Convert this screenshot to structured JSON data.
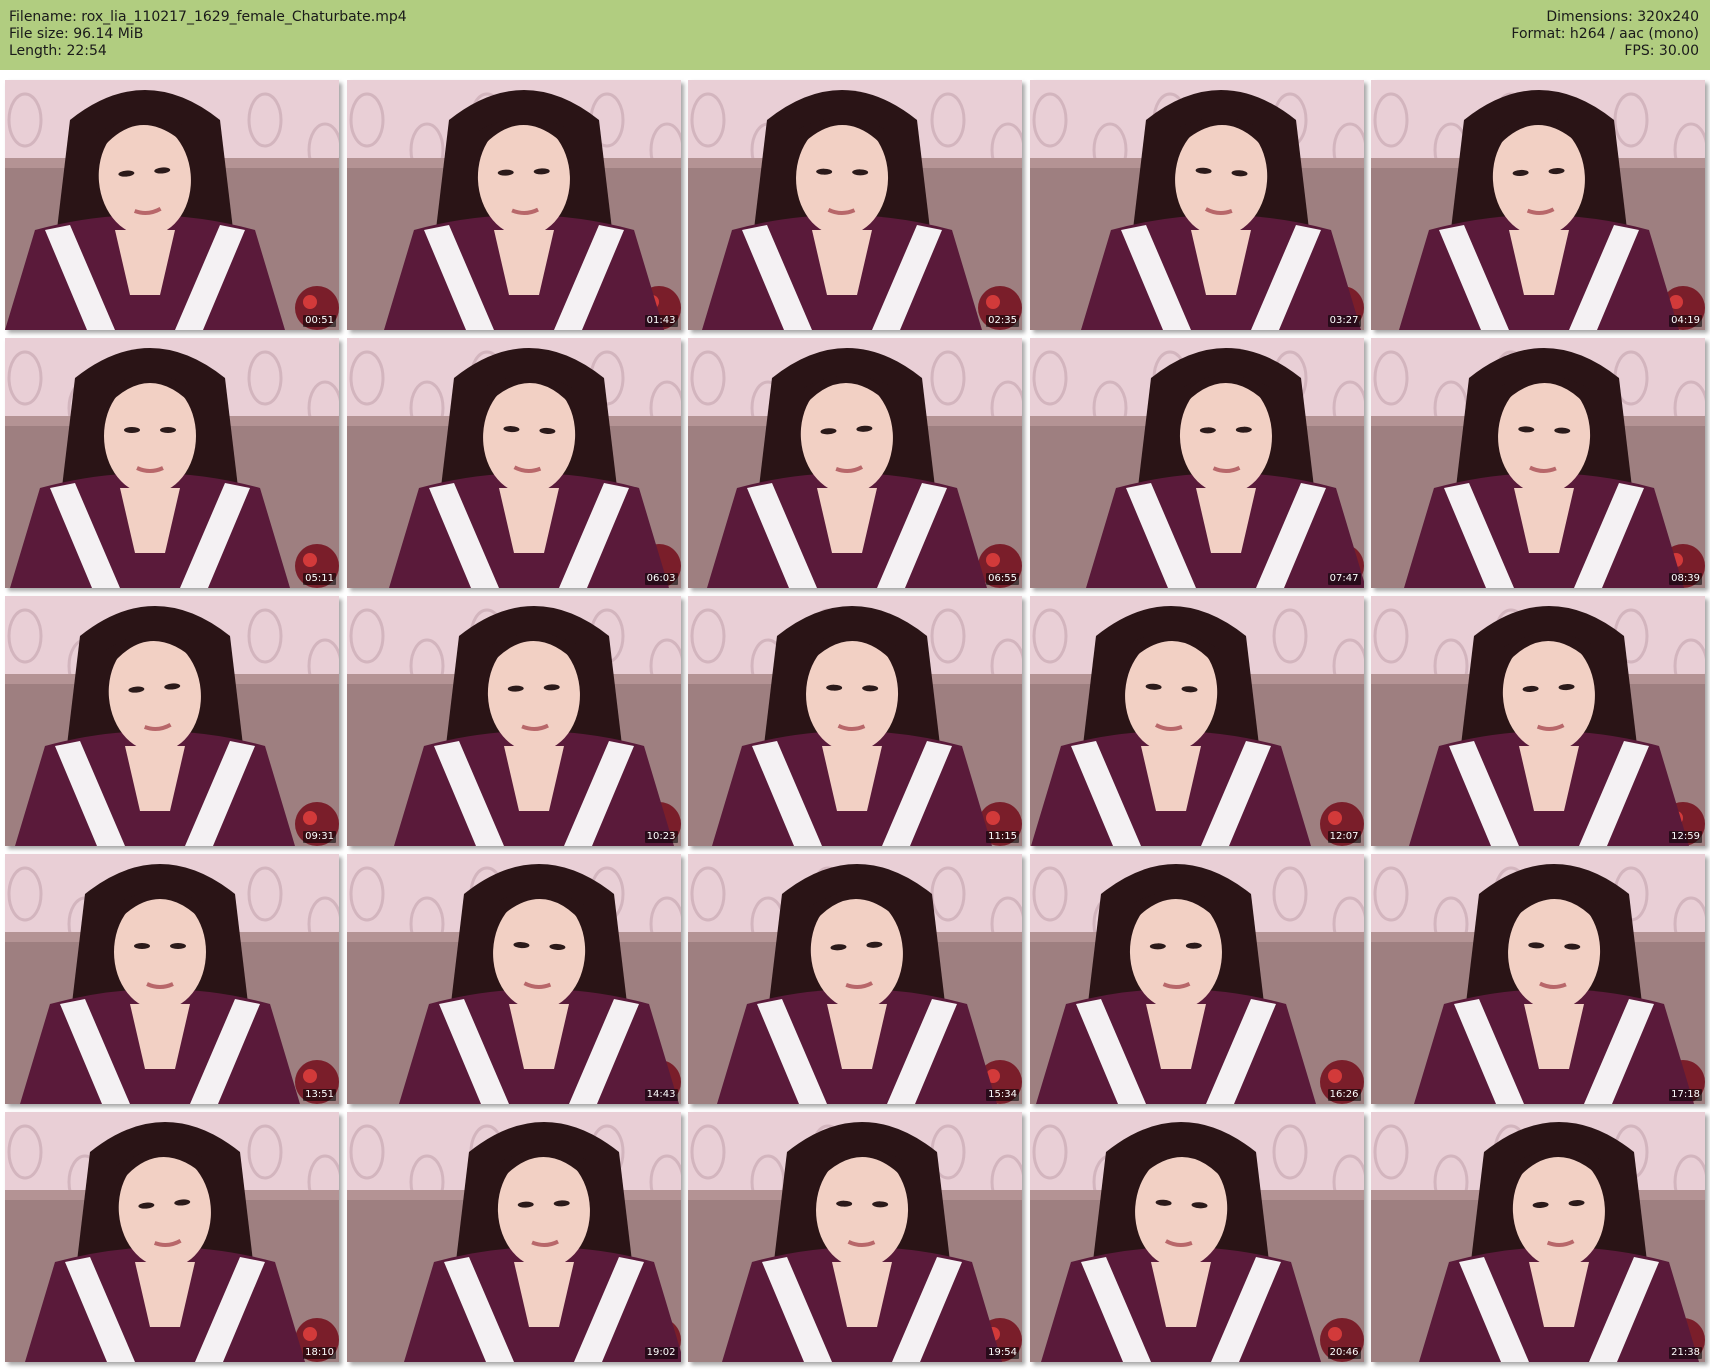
{
  "header": {
    "filename_label": "Filename: rox_lia_110217_1629_female_Chaturbate.mp4",
    "filesize_label": "File size: 96.14 MiB",
    "length_label": "Length: 22:54",
    "dimensions_label": "Dimensions: 320x240",
    "format_label": "Format: h264 / aac (mono)",
    "fps_label": "FPS: 30.00"
  },
  "colors": {
    "header_bg": "#b1cd80",
    "wallpaper": "#e9cfd6",
    "sofa": "#9e7f80",
    "hoodie": "#5a1a3a",
    "stripe": "#f4f1f3",
    "hair": "#2a1416",
    "skin": "#f2d0c4"
  },
  "thumbnails": [
    {
      "timestamp": "00:51"
    },
    {
      "timestamp": "01:43"
    },
    {
      "timestamp": "02:35"
    },
    {
      "timestamp": "03:27"
    },
    {
      "timestamp": "04:19"
    },
    {
      "timestamp": "05:11"
    },
    {
      "timestamp": "06:03"
    },
    {
      "timestamp": "06:55"
    },
    {
      "timestamp": "07:47"
    },
    {
      "timestamp": "08:39"
    },
    {
      "timestamp": "09:31"
    },
    {
      "timestamp": "10:23"
    },
    {
      "timestamp": "11:15"
    },
    {
      "timestamp": "12:07"
    },
    {
      "timestamp": "12:59"
    },
    {
      "timestamp": "13:51"
    },
    {
      "timestamp": "14:43"
    },
    {
      "timestamp": "15:34"
    },
    {
      "timestamp": "16:26"
    },
    {
      "timestamp": "17:18"
    },
    {
      "timestamp": "18:10"
    },
    {
      "timestamp": "19:02"
    },
    {
      "timestamp": "19:54"
    },
    {
      "timestamp": "20:46"
    },
    {
      "timestamp": "21:38"
    }
  ]
}
